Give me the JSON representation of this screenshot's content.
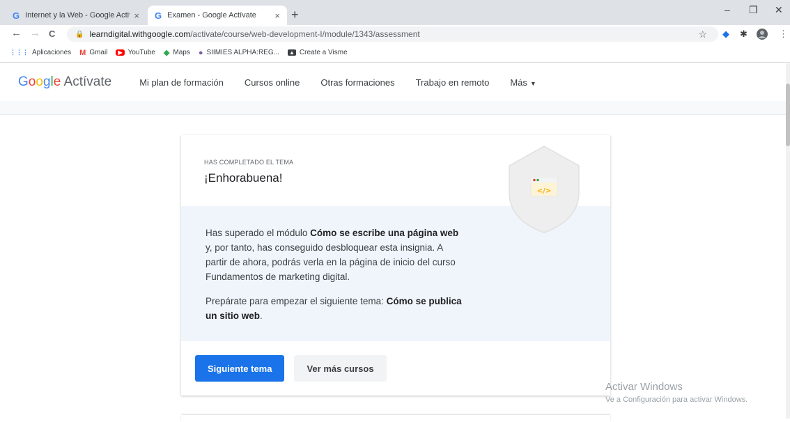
{
  "tabs": [
    {
      "favicon": "G",
      "title": "Internet y la Web - Google Activa",
      "close": "×"
    },
    {
      "favicon": "G",
      "title": "Examen - Google Actívate",
      "close": "×"
    }
  ],
  "new_tab": "+",
  "window": {
    "minimize": "–",
    "restore": "❐",
    "close": "✕"
  },
  "toolbar": {
    "back": "←",
    "forward": "→",
    "reload": "C",
    "star": "☆"
  },
  "address": {
    "domain": "learndigital.withgoogle.com",
    "path": "/activate/course/web-development-I/module/1343/assessment"
  },
  "bookmarks": [
    {
      "icon": "grid-icon",
      "glyph": "⋮⋮⋮",
      "label": "Aplicaciones",
      "color": "#4285f4"
    },
    {
      "icon": "gmail-icon",
      "glyph": "M",
      "label": "Gmail",
      "color": "#ea4335"
    },
    {
      "icon": "youtube-icon",
      "glyph": "▶",
      "label": "YouTube",
      "color": "#ff0000"
    },
    {
      "icon": "maps-icon",
      "glyph": "◆",
      "label": "Maps",
      "color": "#34a853"
    },
    {
      "icon": "siimies-icon",
      "glyph": "●",
      "label": "SIIMIES ALPHA:REG...",
      "color": "#7b5ea7"
    },
    {
      "icon": "visme-icon",
      "glyph": "▲",
      "label": "Create a Visme",
      "color": "#3c4043"
    }
  ],
  "site": {
    "logo": {
      "g": "G",
      "o1": "o",
      "o2": "o",
      "g2": "g",
      "l": "l",
      "e": "e",
      "rest": " Actívate"
    },
    "nav": [
      {
        "label": "Mi plan de formación"
      },
      {
        "label": "Cursos online"
      },
      {
        "label": "Otras formaciones"
      },
      {
        "label": "Trabajo en remoto"
      },
      {
        "label": "Más",
        "caret": "▼"
      }
    ]
  },
  "card": {
    "kicker": "HAS COMPLETADO EL TEMA",
    "headline": "¡Enhorabuena!",
    "badge_code": "</>",
    "p1": {
      "a": "Has superado el módulo ",
      "b": "Cómo se escribe una página web",
      "c": " y, por tanto, has conseguido desbloquear esta insignia. A partir de ahora, podrás verla en la página de inicio del curso Fundamentos de marketing digital."
    },
    "p2": {
      "a": "Prepárate para empezar el siguiente tema: ",
      "b": "Cómo se publica un sitio web",
      "c": "."
    },
    "primary_button": "Siguiente tema",
    "secondary_button": "Ver más cursos"
  },
  "watermark": {
    "line1": "Activar Windows",
    "line2": "Ve a Configuración para activar Windows."
  },
  "colors": {
    "accent": "#1a73e8",
    "body_bg": "#f0f5fc"
  }
}
